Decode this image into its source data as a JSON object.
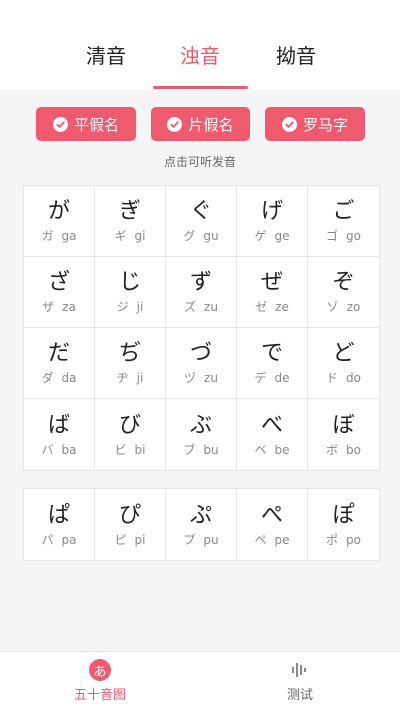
{
  "tabs": {
    "items": [
      {
        "label": "清音"
      },
      {
        "label": "浊音"
      },
      {
        "label": "拗音"
      }
    ],
    "active": "浊音"
  },
  "toggles": [
    {
      "label": "平假名",
      "checked": true
    },
    {
      "label": "片假名",
      "checked": true
    },
    {
      "label": "罗马字",
      "checked": true
    }
  ],
  "hint": "点击可听发音",
  "grid1": [
    {
      "hira": "が",
      "kata": "ガ",
      "romaji": "ga"
    },
    {
      "hira": "ぎ",
      "kata": "ギ",
      "romaji": "gi"
    },
    {
      "hira": "ぐ",
      "kata": "グ",
      "romaji": "gu"
    },
    {
      "hira": "げ",
      "kata": "ゲ",
      "romaji": "ge"
    },
    {
      "hira": "ご",
      "kata": "ゴ",
      "romaji": "go"
    },
    {
      "hira": "ざ",
      "kata": "ザ",
      "romaji": "za"
    },
    {
      "hira": "じ",
      "kata": "ジ",
      "romaji": "ji"
    },
    {
      "hira": "ず",
      "kata": "ズ",
      "romaji": "zu"
    },
    {
      "hira": "ぜ",
      "kata": "ゼ",
      "romaji": "ze"
    },
    {
      "hira": "ぞ",
      "kata": "ゾ",
      "romaji": "zo"
    },
    {
      "hira": "だ",
      "kata": "ダ",
      "romaji": "da"
    },
    {
      "hira": "ぢ",
      "kata": "ヂ",
      "romaji": "ji"
    },
    {
      "hira": "づ",
      "kata": "ヅ",
      "romaji": "zu"
    },
    {
      "hira": "で",
      "kata": "デ",
      "romaji": "de"
    },
    {
      "hira": "ど",
      "kata": "ド",
      "romaji": "do"
    },
    {
      "hira": "ば",
      "kata": "バ",
      "romaji": "ba"
    },
    {
      "hira": "び",
      "kata": "ビ",
      "romaji": "bi"
    },
    {
      "hira": "ぶ",
      "kata": "ブ",
      "romaji": "bu"
    },
    {
      "hira": "べ",
      "kata": "ベ",
      "romaji": "be"
    },
    {
      "hira": "ぼ",
      "kata": "ボ",
      "romaji": "bo"
    }
  ],
  "grid2": [
    {
      "hira": "ぱ",
      "kata": "パ",
      "romaji": "pa"
    },
    {
      "hira": "ぴ",
      "kata": "ピ",
      "romaji": "pi"
    },
    {
      "hira": "ぷ",
      "kata": "プ",
      "romaji": "pu"
    },
    {
      "hira": "ぺ",
      "kata": "ペ",
      "romaji": "pe"
    },
    {
      "hira": "ぽ",
      "kata": "ポ",
      "romaji": "po"
    }
  ],
  "bottom_nav": {
    "items": [
      {
        "label": "五十音图",
        "icon": "hiragana-a-icon",
        "icon_text": "あ",
        "active": true
      },
      {
        "label": "测试",
        "icon": "sound-wave-icon",
        "active": false
      }
    ]
  },
  "colors": {
    "accent": "#f05a6e",
    "background": "#f5f5f7"
  }
}
